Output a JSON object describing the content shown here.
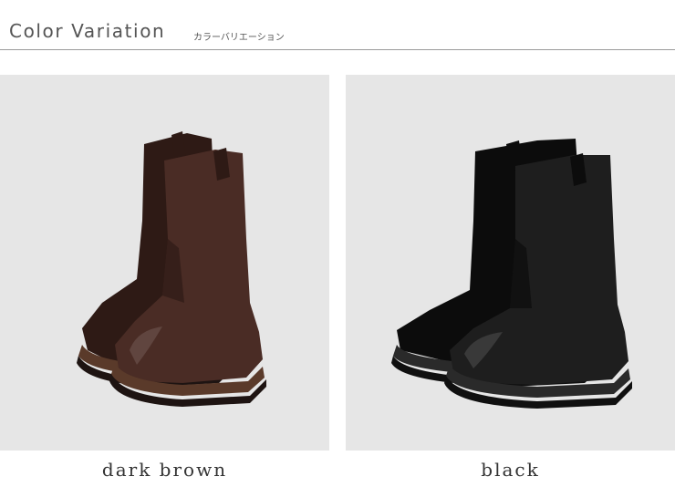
{
  "header": {
    "title": "Color Variation",
    "subtitle": "カラーバリエーション"
  },
  "variations": [
    {
      "label": "dark brown",
      "color": "#4a2c25",
      "shade": "#2e1a15",
      "sole": "#1e1412",
      "welt": "#5a3a2a"
    },
    {
      "label": "black",
      "color": "#1e1e1e",
      "shade": "#0c0c0c",
      "sole": "#101010",
      "welt": "#2a2a2a"
    }
  ],
  "colors": {
    "panel_bg": "#e6e6e6",
    "rule": "#9a9a9a",
    "text": "#333333"
  }
}
